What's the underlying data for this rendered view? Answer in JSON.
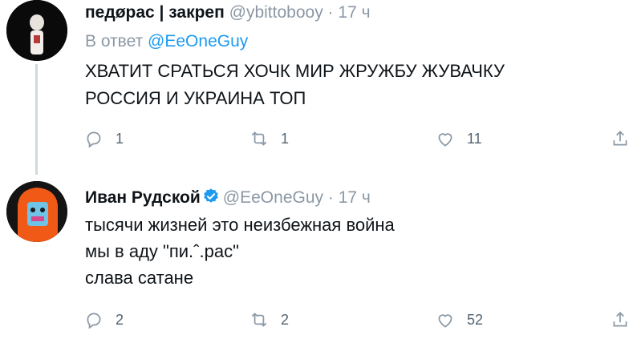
{
  "tweets": [
    {
      "display_name": "педøрас | закреп",
      "handle": "@ybittobooy",
      "separator": "·",
      "time": "17 ч",
      "reply_to_prefix": "В ответ",
      "reply_to_mention": "@EeOneGuy",
      "text_lines": [
        "ХВАТИТ СРАТЬСЯ ХОЧК МИР ЖРУЖБУ ЖУВАЧКУ",
        "РОССИЯ И УКРАИНА ТОП"
      ],
      "replies": "1",
      "retweets": "1",
      "likes": "11"
    },
    {
      "display_name": "Иван Рудской",
      "verified": true,
      "handle": "@EeOneGuy",
      "separator": "·",
      "time": "17 ч",
      "text_lines": [
        "тысячи жизней это неизбежная война",
        "мы в аду \"пи.ˆ.рас\"",
        "слава сатане"
      ],
      "replies": "2",
      "retweets": "2",
      "likes": "52"
    }
  ],
  "colors": {
    "text": "#0f1419",
    "secondary": "#8b98a5",
    "link": "#1d9bf0",
    "thread_line": "#cfd9de",
    "verified": "#1d9bf0"
  },
  "icons": [
    "reply-icon",
    "retweet-icon",
    "like-icon",
    "share-icon",
    "verified-badge-icon"
  ]
}
